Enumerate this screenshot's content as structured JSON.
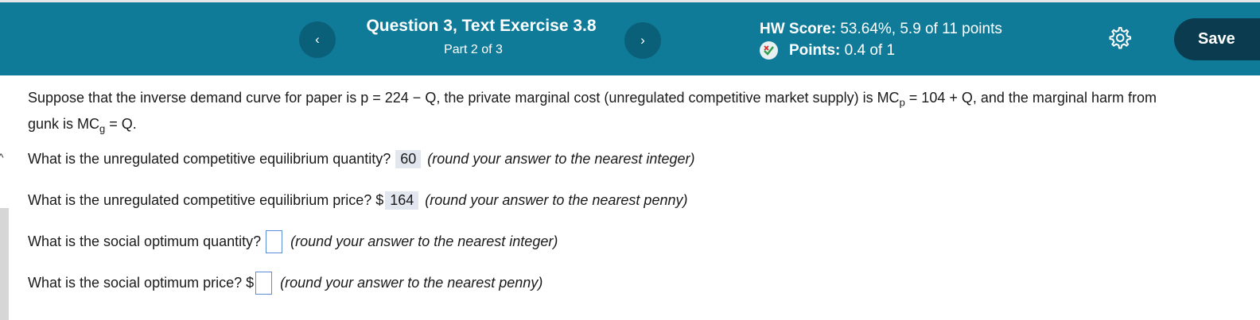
{
  "header": {
    "question_title": "Question 3, Text Exercise 3.8",
    "part": "Part 2 of 3",
    "hw_score_label": "HW Score:",
    "hw_score_value": "53.64%, 5.9 of 11 points",
    "points_label": "Points:",
    "points_value": "0.4 of 1",
    "prev_icon": "‹",
    "next_icon": "›",
    "save_label": "Save"
  },
  "problem": {
    "intro_1": "Suppose that the inverse demand curve for paper is p = 224 − Q, the private marginal cost (unregulated competitive market supply) is MC",
    "sub_p": "p",
    "intro_2": " = 104 + Q, and the marginal harm from",
    "intro_3": "gunk is MC",
    "sub_g": "g",
    "intro_4": " = Q."
  },
  "questions": [
    {
      "prompt": "What is the unregulated competitive equilibrium quantity?",
      "prefix": "",
      "answer": "60",
      "hint": "(round your answer to the nearest integer)"
    },
    {
      "prompt": "What is the unregulated competitive equilibrium price? $",
      "prefix": "",
      "answer": "164",
      "hint": "(round your answer to the nearest penny)"
    },
    {
      "prompt": "What is the social optimum quantity?",
      "prefix": "",
      "answer": "",
      "hint": "(round your answer to the nearest integer)"
    },
    {
      "prompt": "What is the social optimum price? $",
      "prefix": "",
      "answer": "",
      "hint": "(round your answer to the nearest penny)"
    }
  ],
  "left_caret": "^",
  "colors": {
    "header_bg": "#0f7b98",
    "nav_btn": "#0b6079",
    "save_btn": "#0b3b4f",
    "answer_bg": "#e2e7ef"
  }
}
